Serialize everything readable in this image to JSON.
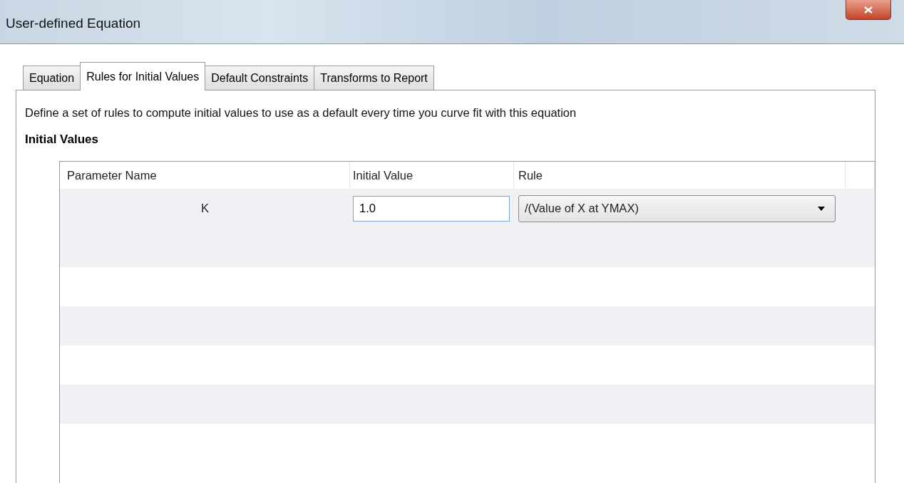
{
  "window": {
    "title": "User-defined Equation"
  },
  "tabs": [
    {
      "label": "Equation",
      "selected": false
    },
    {
      "label": "Rules for Initial Values",
      "selected": true
    },
    {
      "label": "Default Constraints",
      "selected": false
    },
    {
      "label": "Transforms to Report",
      "selected": false
    }
  ],
  "description": "Define a set of rules to compute initial values to use as a default every time you curve fit with this equation",
  "section_title": "Initial Values",
  "table": {
    "columns": [
      "Parameter Name",
      "Initial Value",
      "Rule"
    ],
    "rows": [
      {
        "parameter": "K",
        "initial_value": "1.0",
        "rule": "/(Value of X at YMAX)"
      }
    ]
  }
}
